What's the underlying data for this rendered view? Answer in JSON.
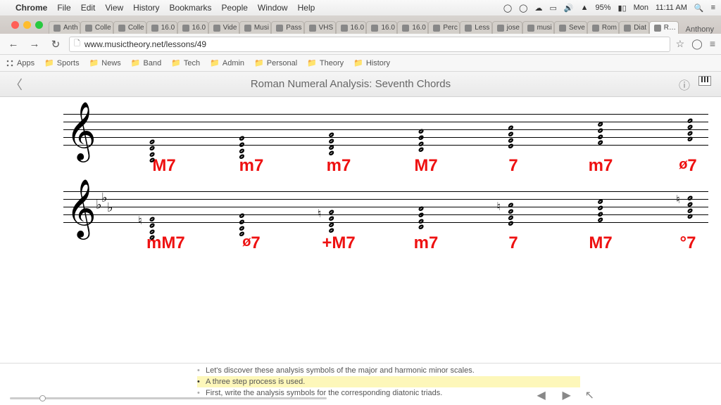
{
  "menubar": {
    "apple": "",
    "app": "Chrome",
    "items": [
      "File",
      "Edit",
      "View",
      "History",
      "Bookmarks",
      "People",
      "Window",
      "Help"
    ],
    "battery": "95%",
    "day": "Mon",
    "time": "11:11 AM",
    "user": "Anthony"
  },
  "tabs": [
    "Anth",
    "Colle",
    "Colle",
    "16.0",
    "16.0",
    "Vide",
    "Musi",
    "Pass",
    "VHS",
    "16.0",
    "16.0",
    "16.0",
    "Perc",
    "Less",
    "jose",
    "musi",
    "Seve",
    "Rom",
    "Diat",
    "R…"
  ],
  "toolbar": {
    "url": "www.musictheory.net/lessons/49"
  },
  "bookmarks": [
    "Apps",
    "Sports",
    "News",
    "Band",
    "Tech",
    "Admin",
    "Personal",
    "Theory",
    "History"
  ],
  "lesson": {
    "title": "Roman Numeral Analysis: Seventh Chords",
    "row1_labels": [
      "M7",
      "m7",
      "m7",
      "M7",
      "7",
      "m7",
      "ø7"
    ],
    "row2_labels": [
      "mM7",
      "ø7",
      "+M7",
      "m7",
      "7",
      "M7",
      "°7"
    ],
    "script": [
      "Let's discover these analysis symbols of the major and harmonic minor scales.",
      "A three step process is used.",
      "First, write the analysis symbols for the corresponding diatonic triads."
    ],
    "active_script_index": 1
  }
}
